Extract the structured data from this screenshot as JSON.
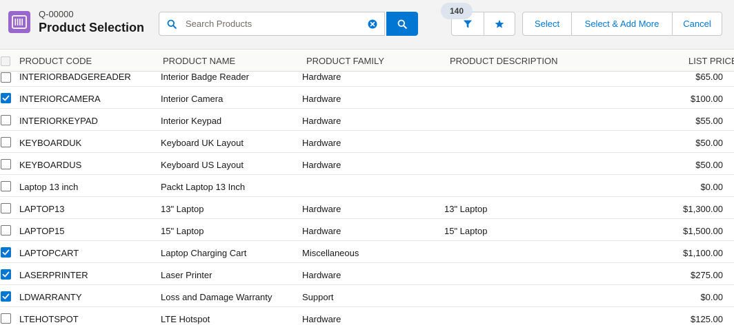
{
  "header": {
    "record_id": "Q-00000",
    "title": "Product Selection",
    "app_icon": "price-book-icon"
  },
  "search": {
    "placeholder": "Search Products",
    "value": ""
  },
  "filter": {
    "count": "140"
  },
  "actions": {
    "select": "Select",
    "select_add_more": "Select & Add More",
    "cancel": "Cancel"
  },
  "columns": {
    "code": "PRODUCT CODE",
    "name": "PRODUCT NAME",
    "family": "PRODUCT FAMILY",
    "description": "PRODUCT DESCRIPTION",
    "price": "LIST PRICE"
  },
  "colors": {
    "accent": "#0176d3",
    "app_icon": "#9966cc"
  },
  "rows": [
    {
      "code": "INTERIORBADGEREADER",
      "name": "Interior Badge Reader",
      "family": "Hardware",
      "description": "",
      "price": "$65.00",
      "checked": false
    },
    {
      "code": "INTERIORCAMERA",
      "name": "Interior Camera",
      "family": "Hardware",
      "description": "",
      "price": "$100.00",
      "checked": true
    },
    {
      "code": "INTERIORKEYPAD",
      "name": "Interior Keypad",
      "family": "Hardware",
      "description": "",
      "price": "$55.00",
      "checked": false
    },
    {
      "code": "KEYBOARDUK",
      "name": "Keyboard UK Layout",
      "family": "Hardware",
      "description": "",
      "price": "$50.00",
      "checked": false
    },
    {
      "code": "KEYBOARDUS",
      "name": "Keyboard US Layout",
      "family": "Hardware",
      "description": "",
      "price": "$50.00",
      "checked": false
    },
    {
      "code": "Laptop 13 inch",
      "name": "Packt Laptop 13 Inch",
      "family": "",
      "description": "",
      "price": "$0.00",
      "checked": false
    },
    {
      "code": "LAPTOP13",
      "name": "13\" Laptop",
      "family": "Hardware",
      "description": "13\" Laptop",
      "price": "$1,300.00",
      "checked": false
    },
    {
      "code": "LAPTOP15",
      "name": "15\" Laptop",
      "family": "Hardware",
      "description": "15\" Laptop",
      "price": "$1,500.00",
      "checked": false
    },
    {
      "code": "LAPTOPCART",
      "name": "Laptop Charging Cart",
      "family": "Miscellaneous",
      "description": "",
      "price": "$1,100.00",
      "checked": true
    },
    {
      "code": "LASERPRINTER",
      "name": "Laser Printer",
      "family": "Hardware",
      "description": "",
      "price": "$275.00",
      "checked": true
    },
    {
      "code": "LDWARRANTY",
      "name": "Loss and Damage Warranty",
      "family": "Support",
      "description": "",
      "price": "$0.00",
      "checked": true
    },
    {
      "code": "LTEHOTSPOT",
      "name": "LTE Hotspot",
      "family": "Hardware",
      "description": "",
      "price": "$125.00",
      "checked": false
    }
  ]
}
